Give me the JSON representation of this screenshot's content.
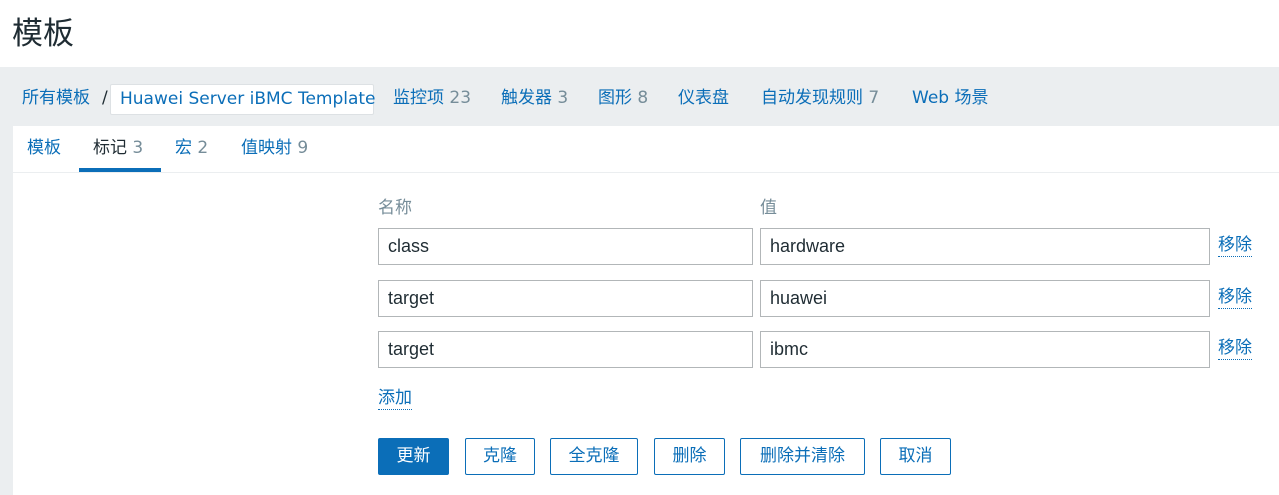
{
  "page": {
    "title": "模板"
  },
  "nav": {
    "all_templates": "所有模板",
    "separator": "/",
    "current_template": "Huawei Server iBMC Template",
    "items": [
      {
        "label": "监控项",
        "count": "23"
      },
      {
        "label": "触发器",
        "count": "3"
      },
      {
        "label": "图形",
        "count": "8"
      },
      {
        "label": "仪表盘",
        "count": ""
      },
      {
        "label": "自动发现规则",
        "count": "7"
      },
      {
        "label": "Web 场景",
        "count": ""
      }
    ]
  },
  "tabs": [
    {
      "label": "模板",
      "count": ""
    },
    {
      "label": "标记",
      "count": "3"
    },
    {
      "label": "宏",
      "count": "2"
    },
    {
      "label": "值映射",
      "count": "9"
    }
  ],
  "tags": {
    "name_header": "名称",
    "value_header": "值",
    "rows": [
      {
        "name": "class",
        "value": "hardware",
        "remove": "移除"
      },
      {
        "name": "target",
        "value": "huawei",
        "remove": "移除"
      },
      {
        "name": "target",
        "value": "ibmc",
        "remove": "移除"
      }
    ],
    "add": "添加"
  },
  "buttons": {
    "update": "更新",
    "clone": "克隆",
    "full_clone": "全克隆",
    "delete": "删除",
    "delete_and_clear": "删除并清除",
    "cancel": "取消"
  },
  "colors": {
    "accent": "#0b6eb8",
    "muted": "#768d99",
    "background": "#ebeef0"
  }
}
